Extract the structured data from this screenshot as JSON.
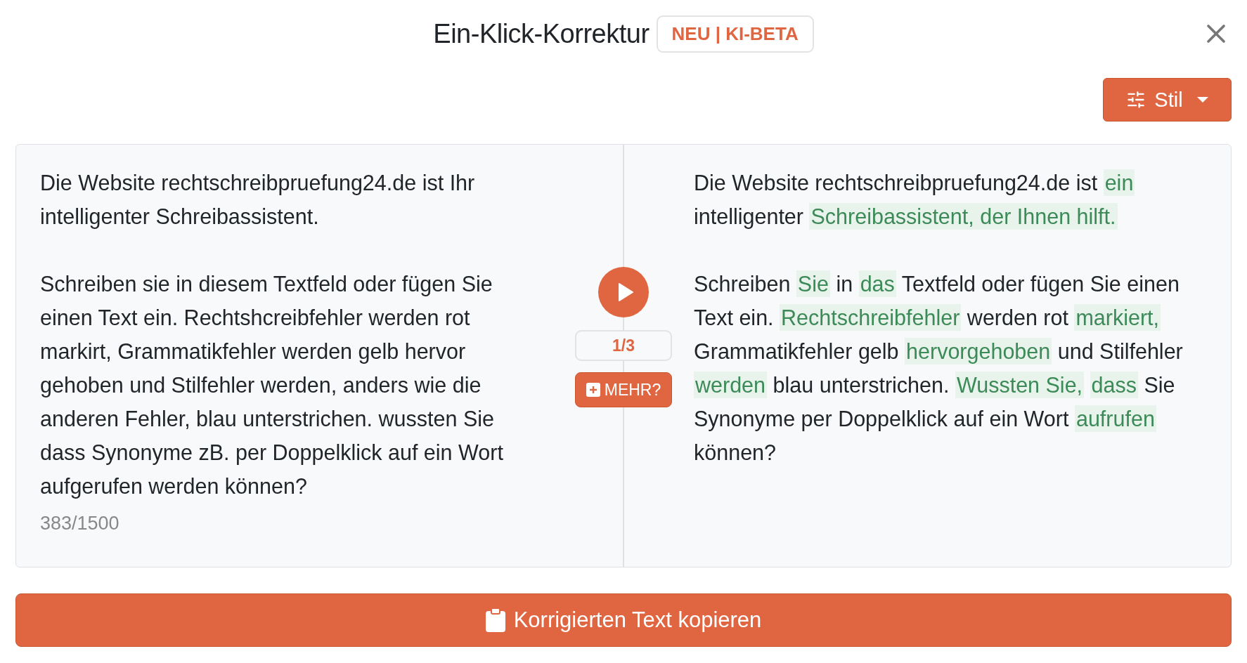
{
  "dialog": {
    "title": "Ein-Klick-Korrektur",
    "badge": "NEU | KI-BETA"
  },
  "style_button": {
    "label": "Stil"
  },
  "original": {
    "paragraphs": [
      "Die Website rechtschreibpruefung24.de ist Ihr intelligenter Schreibassistent.",
      "Schreiben sie in diesem Textfeld oder fügen Sie einen Text ein. Rechtshcreibfehler werden rot markirt, Grammatikfehler werden gelb hervor gehoben und Stilfehler werden, anders wie die anderen Fehler, blau unterstrichen. wussten Sie dass Synonyme zB. per Doppelklick auf ein Wort aufgerufen werden können?"
    ],
    "char_count": "383/1500"
  },
  "controls": {
    "counter": "1/3",
    "more_button": "MEHR?"
  },
  "corrected": {
    "paragraphs": [
      [
        {
          "text": "Die Website rechtschreibpruefung24.de ist",
          "changed": false
        },
        {
          "text": "ein",
          "changed": true
        },
        {
          "text": "intelligenter",
          "changed": false
        },
        {
          "text": "Schreibassistent, der Ihnen hilft.",
          "changed": true
        }
      ],
      [
        {
          "text": "Schreiben",
          "changed": false
        },
        {
          "text": "Sie",
          "changed": true
        },
        {
          "text": "in",
          "changed": false
        },
        {
          "text": "das",
          "changed": true
        },
        {
          "text": "Textfeld oder fügen Sie einen Text ein.",
          "changed": false
        },
        {
          "text": "Rechtschreibfehler",
          "changed": true
        },
        {
          "text": "werden rot",
          "changed": false
        },
        {
          "text": "markiert,",
          "changed": true
        },
        {
          "text": "Grammatikfehler gelb",
          "changed": false
        },
        {
          "text": "hervorgehoben",
          "changed": true
        },
        {
          "text": "und Stilfehler",
          "changed": false
        },
        {
          "text": "werden",
          "changed": true
        },
        {
          "text": "blau unterstrichen.",
          "changed": false
        },
        {
          "text": "Wussten Sie,",
          "changed": true
        },
        {
          "text": "dass",
          "changed": true
        },
        {
          "text": "Sie Synonyme per Doppelklick auf ein Wort",
          "changed": false
        },
        {
          "text": "aufrufen",
          "changed": true
        },
        {
          "text": "können?",
          "changed": false
        }
      ]
    ]
  },
  "copy_button": {
    "label": "Korrigierten Text kopieren"
  }
}
